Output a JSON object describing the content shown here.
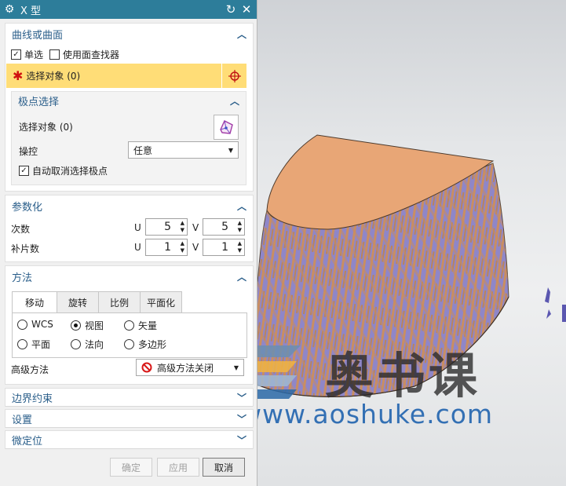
{
  "dialog": {
    "title": "X 型",
    "icons": {
      "settings": "gear-icon",
      "reset": "reset-icon",
      "close": "close-icon"
    }
  },
  "curve_section": {
    "title": "曲线或曲面",
    "single_select_label": "单选",
    "single_select_checked": true,
    "face_finder_label": "使用面查找器",
    "face_finder_checked": false,
    "select_object_label": "选择对象 (0)",
    "pole_select": {
      "title": "极点选择",
      "select_object_label": "选择对象 (0)",
      "manipulate_label": "操控",
      "manipulate_value": "任意",
      "auto_deselect_label": "自动取消选择极点",
      "auto_deselect_checked": true
    }
  },
  "param_section": {
    "title": "参数化",
    "degree_label": "次数",
    "patches_label": "补片数",
    "u_label": "U",
    "v_label": "V",
    "degree_u": "5",
    "degree_v": "5",
    "patches_u": "1",
    "patches_v": "1"
  },
  "method_section": {
    "title": "方法",
    "tabs": [
      "移动",
      "旋转",
      "比例",
      "平面化"
    ],
    "active_tab": "移动",
    "radios": [
      "WCS",
      "视图",
      "矢量",
      "平面",
      "法向",
      "多边形"
    ],
    "selected_radio": "视图",
    "advanced_label": "高级方法",
    "advanced_value": "高级方法关闭"
  },
  "collapsed_sections": [
    "边界约束",
    "设置",
    "微定位"
  ],
  "buttons": {
    "ok": "确定",
    "apply": "应用",
    "cancel": "取消"
  },
  "watermark": {
    "brand": "奥书课",
    "url": "www.aoshuke.com"
  },
  "colors": {
    "titlebar": "#2d7d9a",
    "highlight": "#ffdd77",
    "header_text": "#2a5e8a",
    "surface_top": "#e8a676",
    "surface_stripes": "#7f7ab8"
  }
}
